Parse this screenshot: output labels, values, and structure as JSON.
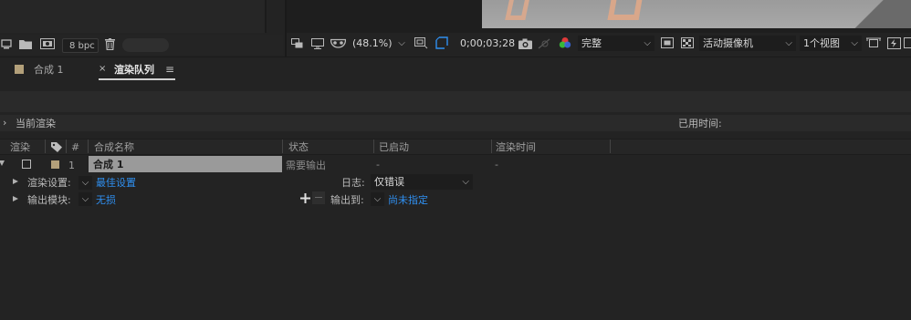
{
  "project_panel": {
    "bpc_label": "8 bpc"
  },
  "viewer": {
    "zoom": "(48.1%)",
    "timecode": "0;00;03;28",
    "resolution": "完整",
    "camera": "活动摄像机",
    "views": "1个视图"
  },
  "tabs": [
    {
      "label": "合成 1",
      "color": "#b3a07a"
    },
    {
      "label": "渲染队列",
      "color": "#b3a07a"
    }
  ],
  "render_queue": {
    "current_render_label": "当前渲染",
    "elapsed_label": "已用时间:",
    "columns": {
      "render": "渲染",
      "num": "#",
      "comp_name": "合成名称",
      "status": "状态",
      "started": "已启动",
      "render_time": "渲染时间"
    },
    "item": {
      "num": "1",
      "comp_name": "合成 1",
      "status": "需要输出",
      "started": "-",
      "render_time": "-",
      "label_color": "#b3a07a",
      "render_settings_label": "渲染设置:",
      "render_settings_value": "最佳设置",
      "log_label": "日志:",
      "log_value": "仅错误",
      "output_module_label": "输出模块:",
      "output_module_value": "无损",
      "output_to_label": "输出到:",
      "output_to_value": "尚未指定"
    }
  },
  "colors": {
    "link": "#2f8ff0",
    "label_swatch": "#b3a07a",
    "selected_name_bg": "#9a9a9a"
  }
}
